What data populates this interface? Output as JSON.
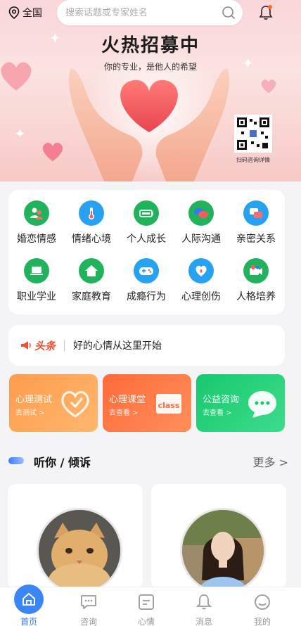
{
  "topbar": {
    "location_label": "全国",
    "search_placeholder": "搜索话题或专家姓名"
  },
  "banner": {
    "title": "火热招募中",
    "subtitle": "你的专业，是他人的希望",
    "qr_caption": "扫码咨询详情"
  },
  "categories": [
    {
      "label": "婚恋情感",
      "icon": "couple-icon",
      "color": "#21b35c"
    },
    {
      "label": "情绪心境",
      "icon": "thermometer-icon",
      "color": "#26a2f0"
    },
    {
      "label": "个人成长",
      "icon": "battery-icon",
      "color": "#21b35c"
    },
    {
      "label": "人际沟通",
      "icon": "chat-bubbles-icon",
      "color": "#21b35c"
    },
    {
      "label": "亲密关系",
      "icon": "chat-bubbles-icon",
      "color": "#26a2f0"
    },
    {
      "label": "职业学业",
      "icon": "laptop-icon",
      "color": "#21b35c"
    },
    {
      "label": "家庭教育",
      "icon": "house-icon",
      "color": "#21b35c"
    },
    {
      "label": "成瘾行为",
      "icon": "gamepad-icon",
      "color": "#26a2f0"
    },
    {
      "label": "心理创伤",
      "icon": "heart-drop-icon",
      "color": "#26a2f0"
    },
    {
      "label": "人格培养",
      "icon": "camera-icon",
      "color": "#21b35c"
    }
  ],
  "news": {
    "tag": "头条",
    "text": "好的心情从这里开始"
  },
  "promos": [
    {
      "title": "心理测试",
      "sub": "去测试 >",
      "color_a": "#ff9b4d",
      "color_b": "#ffb36a"
    },
    {
      "title": "心理课堂",
      "sub": "去查看 >",
      "color_a": "#ff6a3a",
      "color_b": "#ff8a55"
    },
    {
      "title": "公益咨询",
      "sub": "去查看 >",
      "color_a": "#17c96e",
      "color_b": "#3ddc8a"
    }
  ],
  "section": {
    "title": "听你 / 倾诉",
    "more": "更多 >"
  },
  "tabbar": [
    {
      "label": "首页",
      "icon": "home-icon"
    },
    {
      "label": "咨询",
      "icon": "chat-icon"
    },
    {
      "label": "心情",
      "icon": "mood-note-icon"
    },
    {
      "label": "消息",
      "icon": "bell-icon"
    },
    {
      "label": "我的",
      "icon": "profile-icon"
    }
  ]
}
